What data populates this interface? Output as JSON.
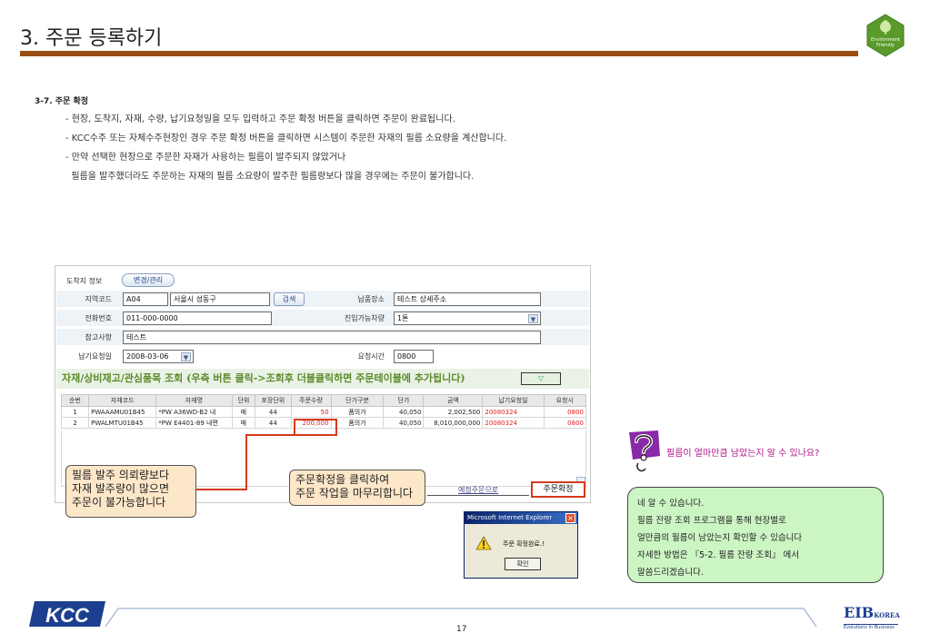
{
  "header": {
    "title": "3. 주문 등록하기",
    "badge_line1": "Environment",
    "badge_line2": "Friendly"
  },
  "section": {
    "heading": "3-7. 주문 확정",
    "bullets": [
      "- 현장, 도착지, 자재, 수량, 납기요청일을 모두 입력하고 주문 확정 버튼을 클릭하면 주문이 완료됩니다.",
      "- KCC수주 또는 자체수주현장인 경우 주문 확정 버튼을 클릭하면 시스템이 주문한 자재의 필름 소요량을 계산합니다.",
      "- 만약 선택한 현장으로 주문한 자재가 사용하는 필름이 발주되지 않았거나",
      "  필름을 발주했더라도 주문하는 자재의 필름 소요량이 발주한 필름량보다 많을 경우에는 주문이 불가합니다."
    ]
  },
  "form": {
    "dest_info_label": "도착지 정보",
    "edit_button": "변경/관리",
    "region_code_label": "지역코드",
    "region_code": "A04",
    "region_name": "서울시 성동구",
    "search_button": "검색",
    "delivery_place_label": "납품장소",
    "delivery_place": "테스트 상세주소",
    "phone_label": "전화번호",
    "phone": "011-000-0000",
    "vehicle_label": "진입가능차량",
    "vehicle": "1톤",
    "reference_label": "참고사항",
    "reference": "테스트",
    "due_date_label": "납기요청일",
    "due_date": "2008-03-06",
    "request_time_label": "요청시간",
    "request_time": "0800"
  },
  "banner": {
    "text": "자재/상비재고/관심품목 조회 (우측 버튼 클릭->조회후 더블클릭하면 주문테이블에 추가됩니다)",
    "button": "▽"
  },
  "grid": {
    "columns": [
      "순번",
      "자재코드",
      "자재명",
      "단위",
      "포장단위",
      "주문수량",
      "단가구분",
      "단가",
      "금액",
      "납기요청일",
      "요청시"
    ],
    "rows": [
      [
        "1",
        "PWAAAMU01B45",
        "*PW A36WD-B2 내",
        "매",
        "44",
        "50",
        "품의가",
        "40,050",
        "2,002,500",
        "20080324",
        "0800"
      ],
      [
        "2",
        "PWALMTU01B45",
        "*PW E4401-89 내면",
        "매",
        "44",
        "200,000",
        "품의가",
        "40,050",
        "8,010,000,000",
        "20080324",
        "0800"
      ]
    ]
  },
  "callouts": {
    "film_left": [
      "필름 발주 의뢰량보다",
      "자재 발주량이 많으면",
      "주문이 불가능합니다"
    ],
    "confirm_mid": [
      "주문확정을 클릭하여",
      "주문 작업을 마무리합니다"
    ]
  },
  "actions": {
    "reserve_link": "예정주문으로",
    "confirm_button": "주문확정"
  },
  "dialog": {
    "title": "Microsoft Internet Explorer",
    "message": "주문 확정완료.!",
    "ok": "확인"
  },
  "qa": {
    "question": "필름이 얼마만큼 남았는지 알 수 있나요?",
    "answer": [
      "네 알 수 있습니다.",
      "필름 잔량 조회 프로그램을 통해 현장별로",
      "얼만큼의 필름이 남았는지 확인할 수 있습니다",
      "자세한 방법은 『5-2. 필름 잔량 조회』 에서",
      "말씀드리겠습니다."
    ]
  },
  "footer": {
    "left_logo": "KCC",
    "page_number": "17",
    "right_logo": "EIB",
    "right_logo_sub": "KOREA",
    "right_tagline": "Evolutions In Business"
  },
  "colors": {
    "rule": "#9a4d12",
    "callout_red": "#d63a1e",
    "question_magenta": "#b0148a",
    "answer_green": "#ccf5c4",
    "callout_tan": "#fde7c9"
  }
}
